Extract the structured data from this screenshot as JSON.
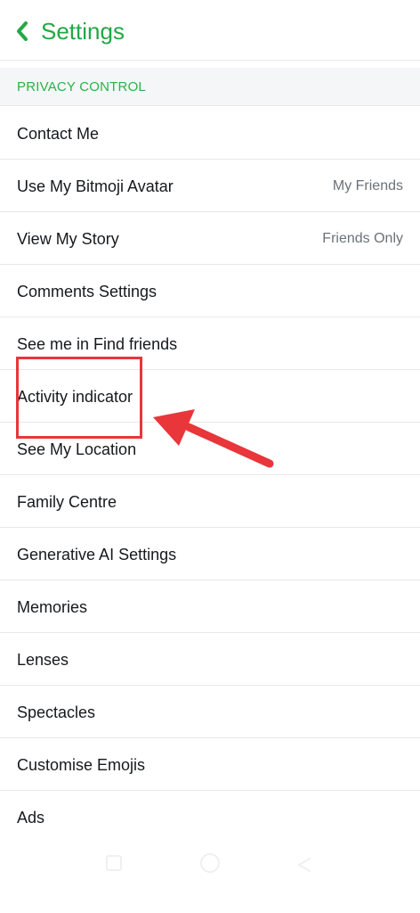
{
  "header": {
    "title": "Settings",
    "back_icon": "chevron-left-icon",
    "accent_color": "#23a845"
  },
  "section": {
    "label": "PRIVACY CONTROL"
  },
  "rows": [
    {
      "label": "Contact Me",
      "value": ""
    },
    {
      "label": "Use My Bitmoji Avatar",
      "value": "My Friends"
    },
    {
      "label": "View My Story",
      "value": "Friends Only"
    },
    {
      "label": "Comments Settings",
      "value": ""
    },
    {
      "label": "See me in Find friends",
      "value": ""
    },
    {
      "label": "Activity indicator",
      "value": ""
    },
    {
      "label": "See My Location",
      "value": ""
    },
    {
      "label": "Family Centre",
      "value": ""
    },
    {
      "label": "Generative AI Settings",
      "value": ""
    },
    {
      "label": "Memories",
      "value": ""
    },
    {
      "label": "Lenses",
      "value": ""
    },
    {
      "label": "Spectacles",
      "value": ""
    },
    {
      "label": "Customise Emojis",
      "value": ""
    },
    {
      "label": "Ads",
      "value": ""
    }
  ],
  "annotation": {
    "highlighted_row": "Activity indicator",
    "color": "#e8363b"
  },
  "navbar": {
    "icons": [
      "recents-icon",
      "home-icon",
      "back-icon"
    ]
  }
}
